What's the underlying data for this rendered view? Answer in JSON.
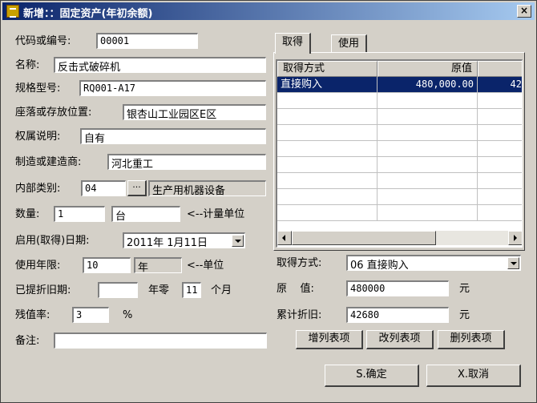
{
  "window": {
    "title": "新增：：固定资产(年初余额)",
    "close_label": "×"
  },
  "form": {
    "code_label": "代码或编号:",
    "code_value": "00001",
    "name_label": "名称:",
    "name_value": "反击式破碎机",
    "spec_label": "规格型号:",
    "spec_value": "RQ001-A17",
    "location_label": "座落或存放位置:",
    "location_value": "银杏山工业园区E区",
    "ownership_label": "权属说明:",
    "ownership_value": "自有",
    "maker_label": "制造或建造商:",
    "maker_value": "河北重工",
    "category_label": "内部类别:",
    "category_code": "04",
    "category_browse": "···",
    "category_name": "生产用机器设备",
    "quantity_label": "数量:",
    "quantity_value": "1",
    "unit_value": "台",
    "unit_hint": "<--计量单位",
    "start_date_label": "启用(取得)日期:",
    "start_date_value": "2011年 1月11日",
    "life_label": "使用年限:",
    "life_value": "10",
    "life_unit_value": "年",
    "life_hint": "<--单位",
    "depr_period_label": "已提折旧期:",
    "depr_years_value": "",
    "depr_year_text": "年零",
    "depr_months_value": "11",
    "depr_month_text": "个月",
    "residual_label": "残值率:",
    "residual_value": "3",
    "residual_unit": "%",
    "remark_label": "备注:",
    "remark_value": ""
  },
  "tabs": [
    {
      "label": "取得"
    },
    {
      "label": "使用"
    }
  ],
  "grid": {
    "columns": [
      "取得方式",
      "原值",
      ""
    ],
    "rows": [
      {
        "method": "直接购入",
        "original": "480,000.00",
        "accum": "42"
      }
    ]
  },
  "acquire": {
    "method_label": "取得方式:",
    "method_value": "06 直接购入",
    "original_label": "原    值:",
    "original_value": "480000",
    "original_unit": "元",
    "accum_label": "累计折旧:",
    "accum_value": "42680",
    "accum_unit": "元",
    "add_row": "增列表项",
    "edit_row": "改列表项",
    "delete_row": "删列表项"
  },
  "footer": {
    "ok": "S.确定",
    "cancel": "X.取消"
  }
}
